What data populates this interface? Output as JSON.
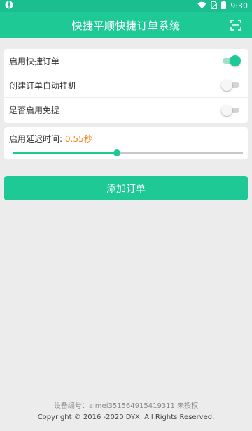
{
  "status_bar": {
    "time": "9:30",
    "icons": [
      "app-notification-icon",
      "wifi-icon",
      "sim-icon",
      "battery-icon"
    ]
  },
  "toolbar": {
    "title": "快捷平顺快捷订单系统",
    "scan_icon": "scan-icon"
  },
  "settings": [
    {
      "label": "启用快捷订单",
      "enabled": true
    },
    {
      "label": "创建订单自动挂机",
      "enabled": false
    },
    {
      "label": "是否启用免提",
      "enabled": false
    }
  ],
  "delay": {
    "label": "启用延迟时间:",
    "value": "0.55秒",
    "slider_fraction": 0.45
  },
  "add_button": {
    "label": "添加订单"
  },
  "footer": {
    "device_info": "设备编号：aimei351564915419311 未授权",
    "copyright": "Copyright © 2016 -2020 DYX. All Rights Reserved."
  },
  "colors": {
    "accent": "#1ec995",
    "status_bar": "#1bbf8f",
    "delay_value": "#f08a24",
    "background": "#ececec"
  }
}
